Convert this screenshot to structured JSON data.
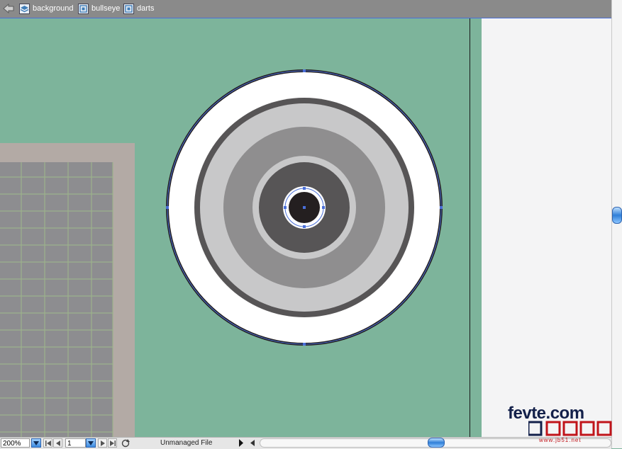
{
  "breadcrumb": {
    "items": [
      {
        "label": "background",
        "icon": "layer-icon"
      },
      {
        "label": "bullseye",
        "icon": "symbol-icon"
      },
      {
        "label": "darts",
        "icon": "symbol-icon"
      }
    ]
  },
  "statusbar": {
    "zoom": "200%",
    "page": "1",
    "file_status": "Unmanaged File"
  },
  "watermark": {
    "logo_text": "fevte.com",
    "url": "www.jb51.net"
  },
  "colors": {
    "canvas_bg": "#7db49b",
    "board_frame": "#b3aaa5",
    "board_grid": "#8d8d90",
    "ring_dark": "#575556",
    "ring_light": "#c8c8c9",
    "ring_mid": "#8f8e8f",
    "bull": "#241f20",
    "selection": "#4a6fd8"
  }
}
